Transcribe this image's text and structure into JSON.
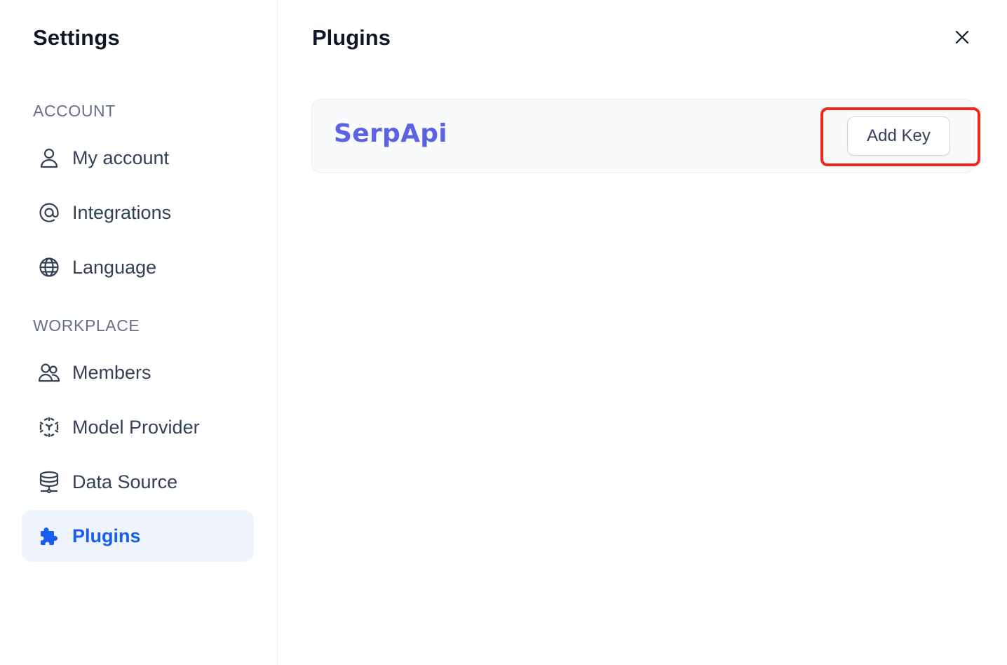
{
  "sidebar": {
    "title": "Settings",
    "sections": [
      {
        "label": "ACCOUNT",
        "items": [
          {
            "label": "My account",
            "icon": "user-icon"
          },
          {
            "label": "Integrations",
            "icon": "at-sign-icon"
          },
          {
            "label": "Language",
            "icon": "globe-icon"
          }
        ]
      },
      {
        "label": "WORKPLACE",
        "items": [
          {
            "label": "Members",
            "icon": "users-icon"
          },
          {
            "label": "Model Provider",
            "icon": "cube-outline-icon"
          },
          {
            "label": "Data Source",
            "icon": "database-icon"
          },
          {
            "label": "Plugins",
            "icon": "puzzle-piece-icon",
            "active": true
          }
        ]
      }
    ]
  },
  "main": {
    "title": "Plugins",
    "plugins": [
      {
        "name": "SerpApi",
        "action_label": "Add Key"
      }
    ]
  },
  "colors": {
    "accent": "#155eef",
    "active_bg": "#eff4ff",
    "plugin_name": "#5a63e0",
    "highlight": "#f2261b"
  }
}
